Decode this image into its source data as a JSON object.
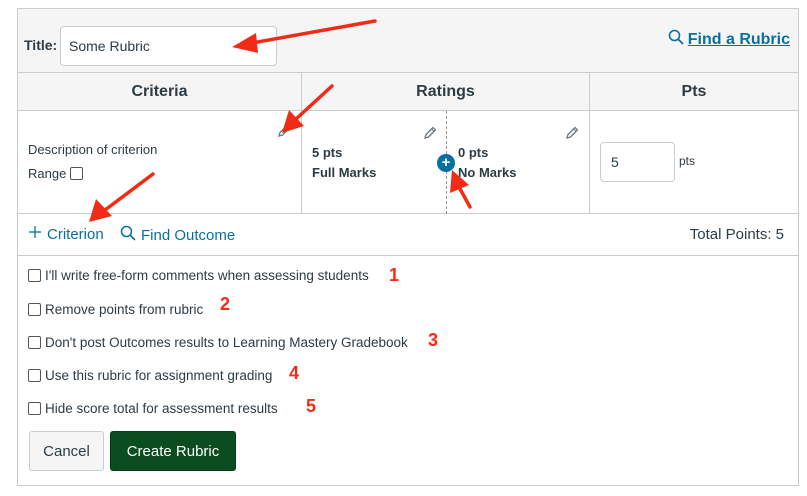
{
  "title_field": {
    "label": "Title:",
    "value": "Some Rubric"
  },
  "find_rubric": {
    "label": "Find a Rubric",
    "icon": "search-icon"
  },
  "table": {
    "headers": [
      "Criteria",
      "Ratings",
      "Pts"
    ],
    "criterion": {
      "description": "Description of criterion",
      "range_label": "Range"
    },
    "ratings": [
      {
        "points": "5 pts",
        "label": "Full Marks"
      },
      {
        "points": "0 pts",
        "label": "No Marks"
      }
    ],
    "points": {
      "value": "5",
      "unit": "pts"
    }
  },
  "tools": {
    "add_criterion": "Criterion",
    "find_outcome": "Find Outcome",
    "total_points": "Total Points: 5"
  },
  "options": [
    {
      "label": "I'll write free-form comments when assessing students",
      "number": "1"
    },
    {
      "label": "Remove points from rubric",
      "number": "2"
    },
    {
      "label": "Don't post Outcomes results to Learning Mastery Gradebook",
      "number": "3"
    },
    {
      "label": "Use this rubric for assignment grading",
      "number": "4"
    },
    {
      "label": "Hide score total for assessment results",
      "number": "5"
    }
  ],
  "buttons": {
    "cancel": "Cancel",
    "create": "Create Rubric"
  },
  "colors": {
    "link": "#0770a3",
    "annotation": "#f22b16",
    "primary_button": "#0b4d1f"
  }
}
